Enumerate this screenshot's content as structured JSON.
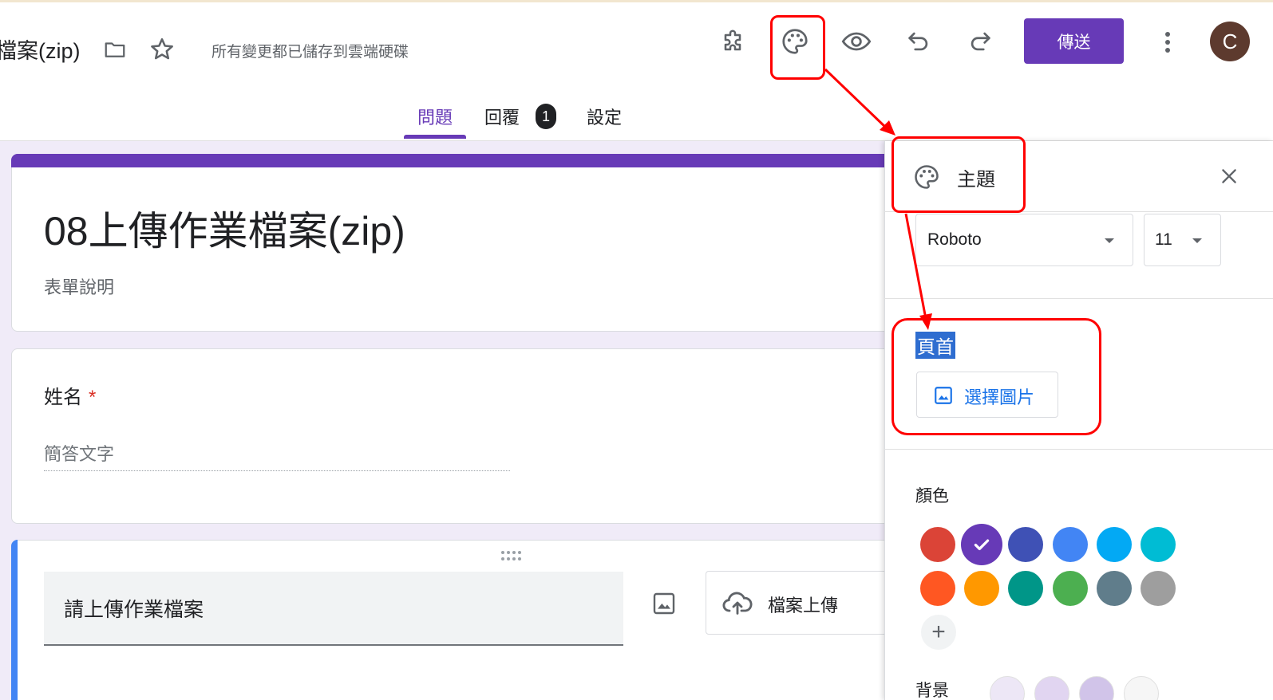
{
  "header": {
    "doc_title_cut": "檔案(zip)",
    "save_status": "所有變更都已儲存到雲端硬碟",
    "send_label": "傳送",
    "avatar_letter": "C"
  },
  "tabs": {
    "questions": "問題",
    "responses": "回覆",
    "responses_count": "1",
    "settings": "設定"
  },
  "form": {
    "title": "08上傳作業檔案(zip)",
    "description": "表單說明",
    "q1_title": "姓名",
    "q1_required": "*",
    "q1_placeholder": "簡答文字",
    "q3_title": "請上傳作業檔案",
    "q3_type": "檔案上傳"
  },
  "theme_panel": {
    "title": "主題",
    "font_family": "Roboto",
    "font_size": "11",
    "header_label": "頁首",
    "choose_image": "選擇圖片",
    "color_label": "顏色",
    "background_label": "背景",
    "colors": [
      "#db4437",
      "#673ab7",
      "#3f51b5",
      "#4285f4",
      "#03a9f4",
      "#00bcd4",
      "#ff5722",
      "#ff9800",
      "#009688",
      "#4caf50",
      "#607d8b",
      "#9e9e9e"
    ],
    "selected_color": "#673ab7",
    "background_colors": [
      "#ede7f6",
      "#e1d5f1",
      "#d1c4e9",
      "#f6f6f6"
    ]
  },
  "icons": {
    "folder": "folder-icon",
    "star": "star-icon",
    "addons": "puzzle-icon",
    "theme": "palette-icon",
    "preview": "eye-icon",
    "undo": "undo-icon",
    "redo": "redo-icon",
    "more": "more-vert-icon",
    "close": "close-icon",
    "image": "image-icon",
    "upload": "cloud-upload-icon",
    "drag": "drag-handle-icon"
  }
}
